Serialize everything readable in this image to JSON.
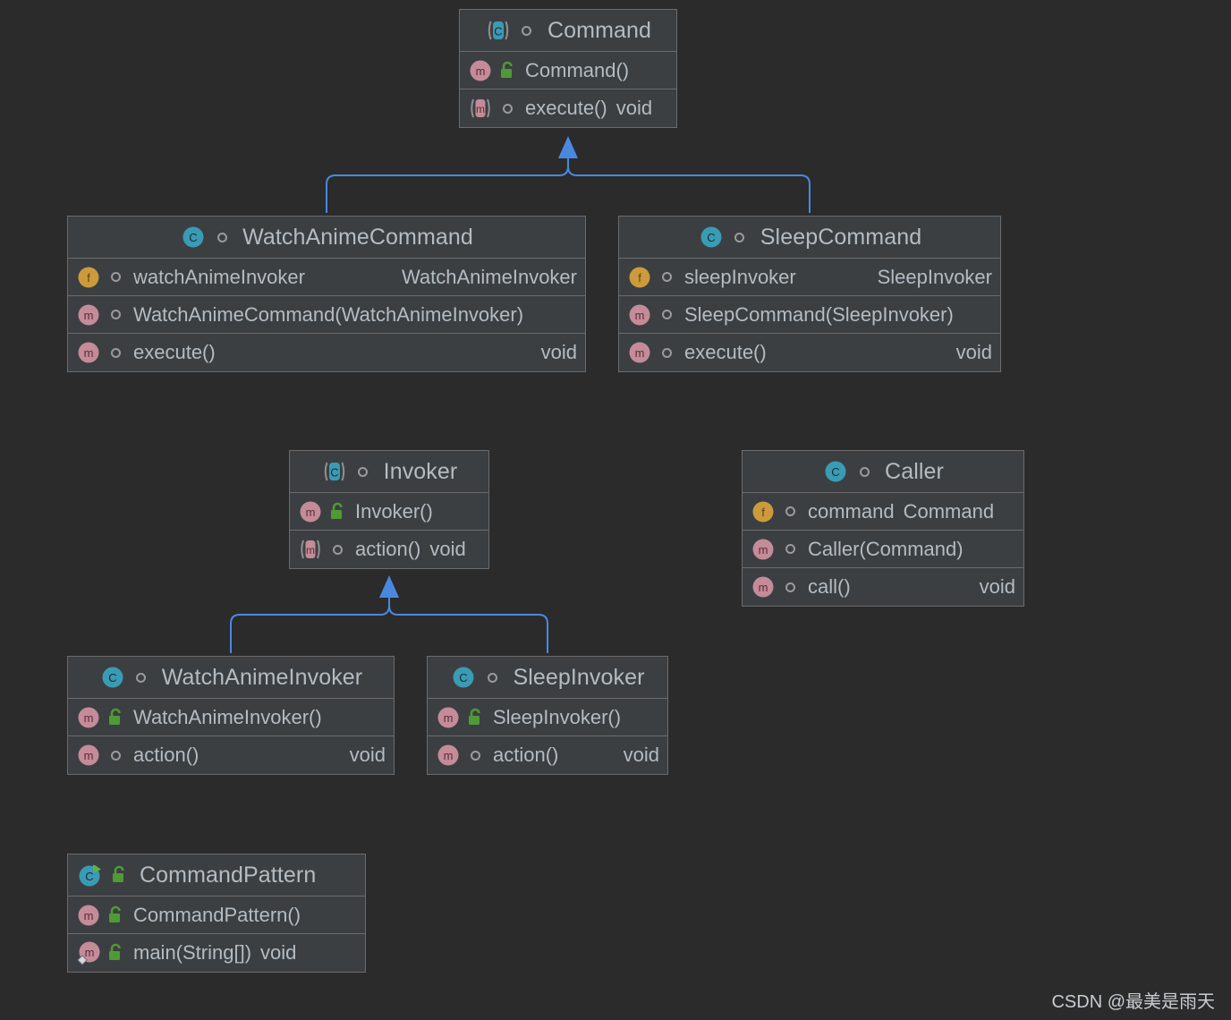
{
  "canvas": {
    "background": "#2b2b2b",
    "box_fill": "#3c3f41",
    "box_border": "#6b6b6b",
    "text_color": "#b3bcc4",
    "connector_color": "#4a88e0",
    "icon_class_teal": "#3a9bb5",
    "icon_method_pink": "#c48b99",
    "icon_field_gold": "#cc9a3c",
    "icon_lock_green": "#4f9a36"
  },
  "watermark": "CSDN @最美是雨天",
  "classes": [
    {
      "id": "command",
      "name": "Command",
      "kind_icon": "abstract-class-icon",
      "header_modifier": "public-visibility-icon",
      "members": [
        {
          "kind_icon": "method-icon",
          "modifier": "unlocked-icon",
          "name": "Command()",
          "type": ""
        },
        {
          "kind_icon": "abstract-method-icon",
          "modifier": "public-visibility-icon",
          "name": "execute()",
          "type": "void",
          "tight": true
        }
      ]
    },
    {
      "id": "watch-anime-command",
      "name": "WatchAnimeCommand",
      "kind_icon": "class-icon",
      "header_modifier": "public-visibility-icon",
      "members": [
        {
          "kind_icon": "field-icon",
          "modifier": "public-visibility-icon",
          "name": "watchAnimeInvoker",
          "type": "WatchAnimeInvoker"
        },
        {
          "kind_icon": "method-icon",
          "modifier": "public-visibility-icon",
          "name": "WatchAnimeCommand(WatchAnimeInvoker)",
          "type": ""
        },
        {
          "kind_icon": "method-icon",
          "modifier": "public-visibility-icon",
          "name": "execute()",
          "type": "void"
        }
      ]
    },
    {
      "id": "sleep-command",
      "name": "SleepCommand",
      "kind_icon": "class-icon",
      "header_modifier": "public-visibility-icon",
      "members": [
        {
          "kind_icon": "field-icon",
          "modifier": "public-visibility-icon",
          "name": "sleepInvoker",
          "type": "SleepInvoker"
        },
        {
          "kind_icon": "method-icon",
          "modifier": "public-visibility-icon",
          "name": "SleepCommand(SleepInvoker)",
          "type": ""
        },
        {
          "kind_icon": "method-icon",
          "modifier": "public-visibility-icon",
          "name": "execute()",
          "type": "void"
        }
      ]
    },
    {
      "id": "invoker",
      "name": "Invoker",
      "kind_icon": "abstract-class-icon",
      "header_modifier": "public-visibility-icon",
      "members": [
        {
          "kind_icon": "method-icon",
          "modifier": "unlocked-icon",
          "name": "Invoker()",
          "type": ""
        },
        {
          "kind_icon": "abstract-method-icon",
          "modifier": "public-visibility-icon",
          "name": "action()",
          "type": "void",
          "tight": true
        }
      ]
    },
    {
      "id": "caller",
      "name": "Caller",
      "kind_icon": "class-icon",
      "header_modifier": "public-visibility-icon",
      "members": [
        {
          "kind_icon": "field-icon",
          "modifier": "public-visibility-icon",
          "name": "command",
          "type": "Command",
          "tight": true
        },
        {
          "kind_icon": "method-icon",
          "modifier": "public-visibility-icon",
          "name": "Caller(Command)",
          "type": ""
        },
        {
          "kind_icon": "method-icon",
          "modifier": "public-visibility-icon",
          "name": "call()",
          "type": "void"
        }
      ]
    },
    {
      "id": "watch-anime-invoker",
      "name": "WatchAnimeInvoker",
      "kind_icon": "class-icon",
      "header_modifier": "public-visibility-icon",
      "members": [
        {
          "kind_icon": "method-icon",
          "modifier": "unlocked-icon",
          "name": "WatchAnimeInvoker()",
          "type": ""
        },
        {
          "kind_icon": "method-icon",
          "modifier": "public-visibility-icon",
          "name": "action()",
          "type": "void"
        }
      ]
    },
    {
      "id": "sleep-invoker",
      "name": "SleepInvoker",
      "kind_icon": "class-icon",
      "header_modifier": "public-visibility-icon",
      "members": [
        {
          "kind_icon": "method-icon",
          "modifier": "unlocked-icon",
          "name": "SleepInvoker()",
          "type": ""
        },
        {
          "kind_icon": "method-icon",
          "modifier": "public-visibility-icon",
          "name": "action()",
          "type": "void",
          "tight": true
        }
      ]
    },
    {
      "id": "command-pattern",
      "name": "CommandPattern",
      "kind_icon": "runnable-class-icon",
      "header_modifier": "unlocked-icon",
      "members": [
        {
          "kind_icon": "method-icon",
          "modifier": "unlocked-icon",
          "name": "CommandPattern()",
          "type": ""
        },
        {
          "kind_icon": "runnable-method-icon",
          "modifier": "unlocked-icon",
          "name": "main(String[])",
          "type": "void",
          "tight": true
        }
      ]
    }
  ],
  "relations": [
    {
      "from": "watch-anime-command",
      "to": "command",
      "type": "generalization"
    },
    {
      "from": "sleep-command",
      "to": "command",
      "type": "generalization"
    },
    {
      "from": "watch-anime-invoker",
      "to": "invoker",
      "type": "generalization"
    },
    {
      "from": "sleep-invoker",
      "to": "invoker",
      "type": "generalization"
    }
  ]
}
